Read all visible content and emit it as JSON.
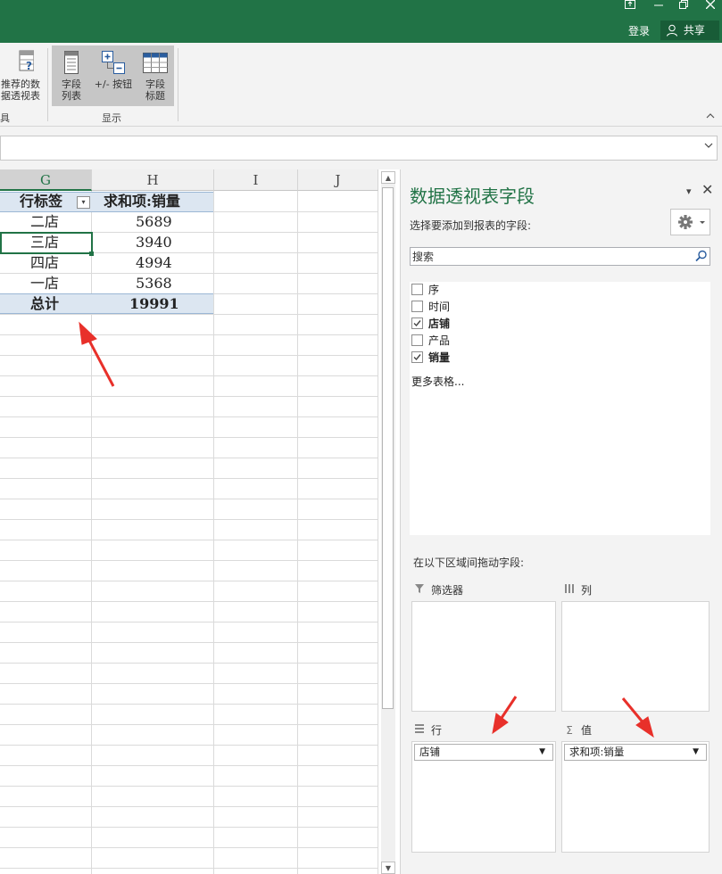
{
  "titlebar": {
    "login": "登录",
    "share": "共享"
  },
  "ribbon": {
    "partial_recommend_line1": "推荐的数",
    "partial_recommend_line2": "据透视表",
    "partial_group_label": "具",
    "field_list_line1": "字段",
    "field_list_line2": "列表",
    "plusminus": "+/- 按钮",
    "field_header_line1": "字段",
    "field_header_line2": "标题",
    "show_group_label": "显示"
  },
  "grid": {
    "columns": [
      "G",
      "H",
      "I",
      "J"
    ],
    "row_label_header": "行标签",
    "value_header": "求和项:销量",
    "rows": [
      {
        "label": "二店",
        "value": "5689"
      },
      {
        "label": "三店",
        "value": "3940"
      },
      {
        "label": "四店",
        "value": "4994"
      },
      {
        "label": "一店",
        "value": "5368"
      }
    ],
    "total_label": "总计",
    "total_value": "19991"
  },
  "pane": {
    "title": "数据透视表字段",
    "subtitle": "选择要添加到报表的字段:",
    "search_placeholder": "搜索",
    "fields": [
      {
        "label": "序",
        "checked": false
      },
      {
        "label": "时间",
        "checked": false
      },
      {
        "label": "店铺",
        "checked": true
      },
      {
        "label": "产品",
        "checked": false
      },
      {
        "label": "销量",
        "checked": true
      }
    ],
    "more_tables": "更多表格...",
    "drag_hint": "在以下区域间拖动字段:",
    "areas": {
      "filter": "筛选器",
      "columns": "列",
      "rows": "行",
      "values": "值",
      "rows_item": "店铺",
      "values_item": "求和项:销量"
    }
  },
  "colors": {
    "title_bar": "#217346",
    "accent": "#217346",
    "pivot_header_band": "#dce6f1",
    "annotation_arrow": "#e8302a"
  }
}
